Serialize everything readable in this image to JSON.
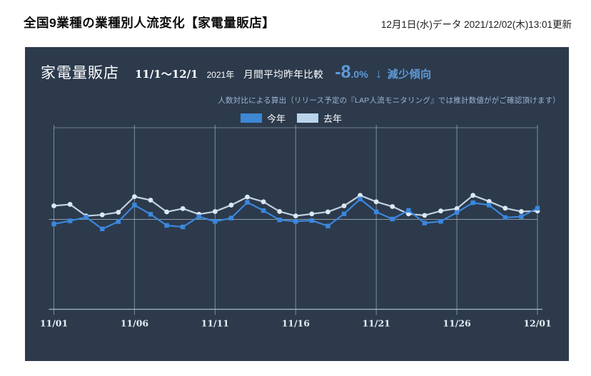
{
  "page": {
    "title": "全国9業種の業種別人流変化【家電量販店】",
    "updated": "12月1日(水)データ 2021/12/02(木)13:01更新"
  },
  "panel": {
    "store_type": "家電量販店",
    "period": "11/1～12/1",
    "year": "2021年",
    "comparison_label": "月間平均昨年比較",
    "change_value": "-8.0%",
    "trend_arrow": "↓",
    "trend_label": "減少傾向",
    "note": "人数対比による算出（リリース予定の『LAP人流モニタリング』では推計数値ががご確認頂けます）",
    "background_color": "#2c3a4c",
    "accent_color": "#5f9bd8"
  },
  "legend": [
    {
      "label": "今年",
      "color": "#3d87d3"
    },
    {
      "label": "去年",
      "color": "#b9d3ea"
    }
  ],
  "chart_data": {
    "type": "line",
    "title": "",
    "xlabel": "",
    "ylabel": "",
    "x": [
      "11/01",
      "11/02",
      "11/03",
      "11/04",
      "11/05",
      "11/06",
      "11/07",
      "11/08",
      "11/09",
      "11/10",
      "11/11",
      "11/12",
      "11/13",
      "11/14",
      "11/15",
      "11/16",
      "11/17",
      "11/18",
      "11/19",
      "11/20",
      "11/21",
      "11/22",
      "11/23",
      "11/24",
      "11/25",
      "11/26",
      "11/27",
      "11/28",
      "11/29",
      "11/30",
      "12/01"
    ],
    "x_tick_labels": [
      "11/01",
      "11/06",
      "11/11",
      "11/16",
      "11/21",
      "11/26",
      "12/01"
    ],
    "tick_every": 5,
    "series": [
      {
        "name": "今年",
        "color": "#3b87dd",
        "marker": "square",
        "marker_color": "#3b87dd",
        "values": [
          -2.5,
          -0.8,
          1.2,
          -5.2,
          -1.2,
          7.8,
          2.8,
          -3.3,
          -4.1,
          1.5,
          -1.1,
          0.7,
          9.3,
          4.8,
          -0.3,
          -1.1,
          -0.6,
          -3.6,
          3.0,
          11.1,
          4.1,
          0.2,
          4.9,
          -2.0,
          -1.1,
          3.8,
          9.1,
          7.8,
          1.0,
          1.5,
          6.1
        ]
      },
      {
        "name": "去年",
        "color": "#c0d2e2",
        "marker": "circle",
        "marker_color": "#dce8f2",
        "values": [
          7.4,
          8.2,
          1.9,
          2.5,
          3.9,
          12.4,
          10.5,
          4.1,
          5.9,
          2.8,
          4.3,
          7.8,
          12.2,
          9.6,
          4.3,
          1.9,
          3.0,
          4.1,
          7.4,
          13.1,
          9.6,
          7.0,
          3.0,
          2.2,
          4.6,
          5.9,
          13.1,
          9.8,
          6.1,
          4.3,
          4.6
        ]
      }
    ],
    "ylim": [
      -50,
      50
    ],
    "baseline": 0,
    "grid": "vertical-date-lines-plus-zero-line",
    "grid_color": "#b3c6d4",
    "tick_color": "#e6edf4",
    "legend_position": "top-center"
  }
}
